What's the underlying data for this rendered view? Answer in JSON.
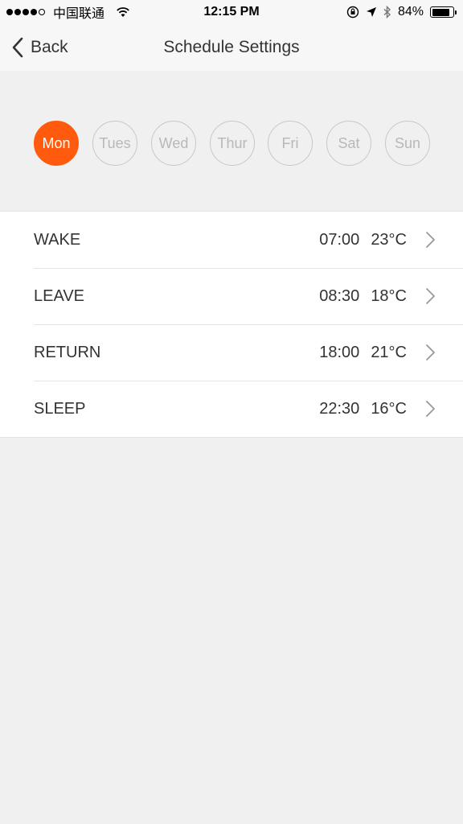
{
  "status_bar": {
    "carrier": "中国联通",
    "time": "12:15 PM",
    "battery": "84%",
    "battery_level": 0.84
  },
  "nav": {
    "back_label": "Back",
    "title": "Schedule Settings"
  },
  "days": [
    {
      "label": "Mon",
      "active": true
    },
    {
      "label": "Tues",
      "active": false
    },
    {
      "label": "Wed",
      "active": false
    },
    {
      "label": "Thur",
      "active": false
    },
    {
      "label": "Fri",
      "active": false
    },
    {
      "label": "Sat",
      "active": false
    },
    {
      "label": "Sun",
      "active": false
    }
  ],
  "schedule": [
    {
      "label": "WAKE",
      "time": "07:00",
      "temp": "23°C"
    },
    {
      "label": "LEAVE",
      "time": "08:30",
      "temp": "18°C"
    },
    {
      "label": "RETURN",
      "time": "18:00",
      "temp": "21°C"
    },
    {
      "label": "SLEEP",
      "time": "22:30",
      "temp": "16°C"
    }
  ],
  "colors": {
    "accent": "#ff5a0d",
    "background": "#f0f0f0",
    "text": "#333333",
    "inactive": "#b8b8b8"
  }
}
